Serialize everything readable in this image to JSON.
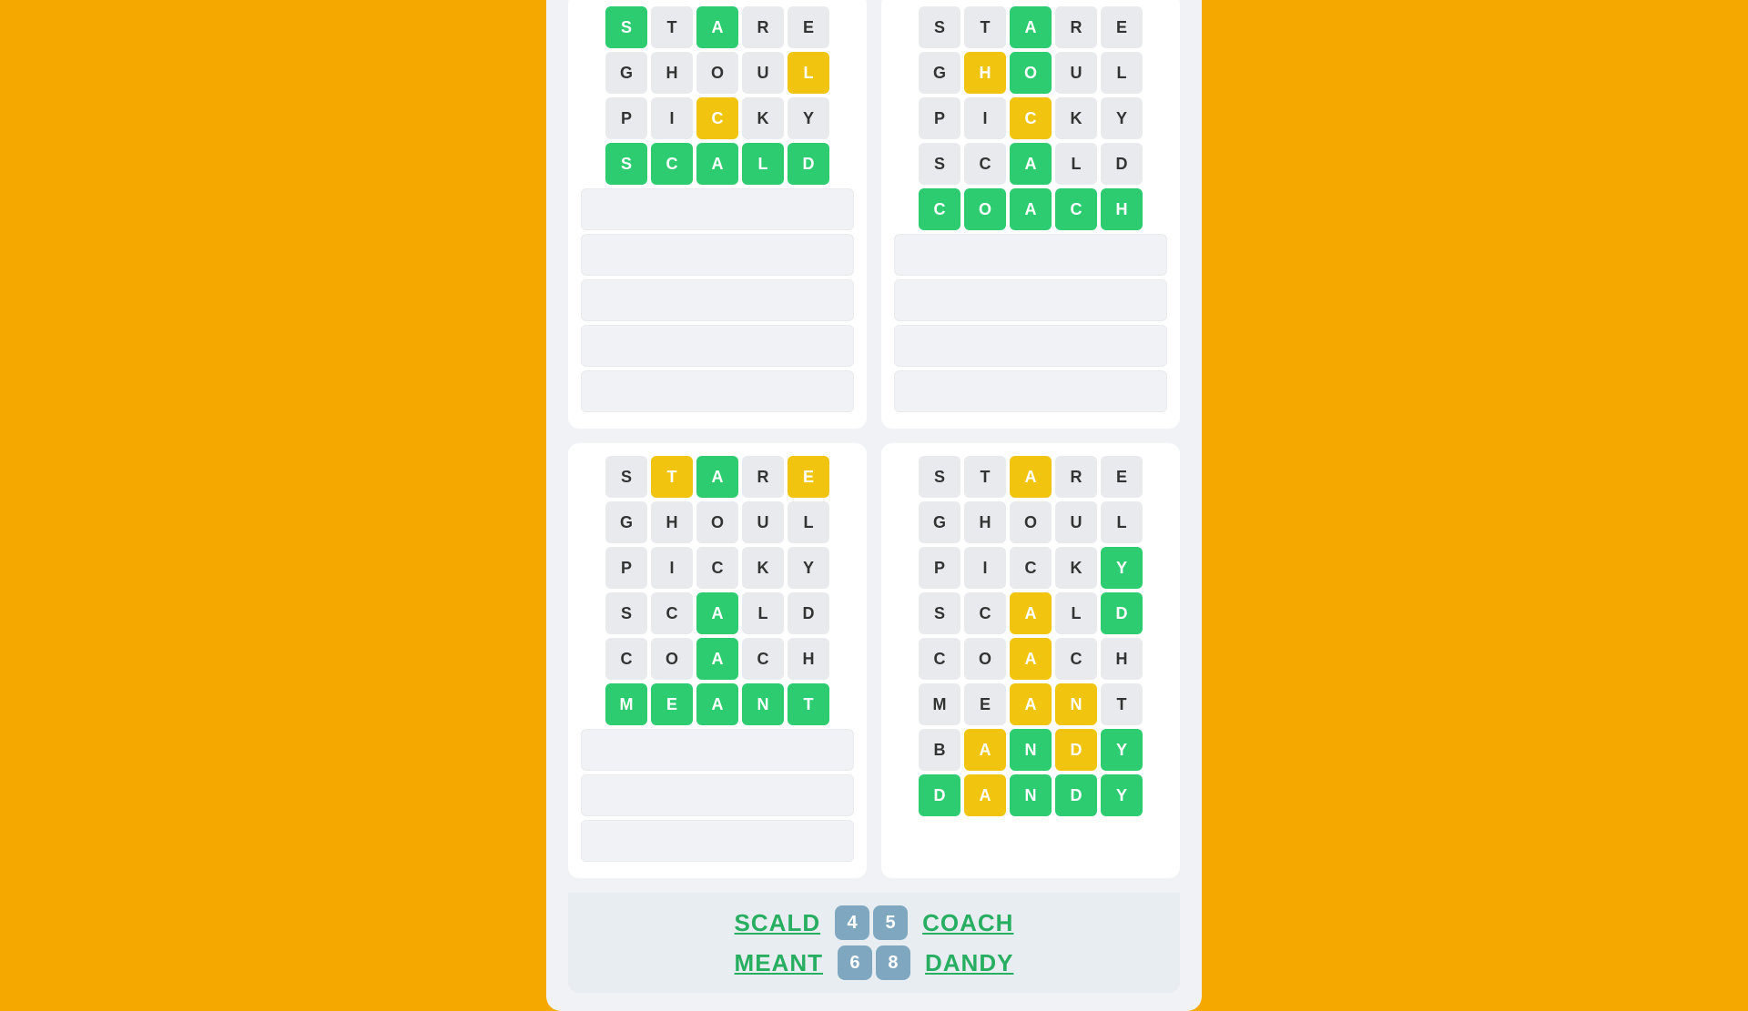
{
  "background_color": "#F5A800",
  "grids": [
    {
      "id": "top-left",
      "rows": [
        [
          {
            "letter": "S",
            "state": "green"
          },
          {
            "letter": "T",
            "state": "normal"
          },
          {
            "letter": "A",
            "state": "green"
          },
          {
            "letter": "R",
            "state": "normal"
          },
          {
            "letter": "E",
            "state": "normal"
          }
        ],
        [
          {
            "letter": "G",
            "state": "normal"
          },
          {
            "letter": "H",
            "state": "normal"
          },
          {
            "letter": "O",
            "state": "normal"
          },
          {
            "letter": "U",
            "state": "normal"
          },
          {
            "letter": "L",
            "state": "yellow"
          }
        ],
        [
          {
            "letter": "P",
            "state": "normal"
          },
          {
            "letter": "I",
            "state": "normal"
          },
          {
            "letter": "C",
            "state": "yellow"
          },
          {
            "letter": "K",
            "state": "normal"
          },
          {
            "letter": "Y",
            "state": "normal"
          }
        ],
        [
          {
            "letter": "S",
            "state": "green"
          },
          {
            "letter": "C",
            "state": "green"
          },
          {
            "letter": "A",
            "state": "green"
          },
          {
            "letter": "L",
            "state": "green"
          },
          {
            "letter": "D",
            "state": "green"
          }
        ]
      ],
      "empty_rows": 5
    },
    {
      "id": "top-right",
      "rows": [
        [
          {
            "letter": "S",
            "state": "normal"
          },
          {
            "letter": "T",
            "state": "normal"
          },
          {
            "letter": "A",
            "state": "green"
          },
          {
            "letter": "R",
            "state": "normal"
          },
          {
            "letter": "E",
            "state": "normal"
          }
        ],
        [
          {
            "letter": "G",
            "state": "normal"
          },
          {
            "letter": "H",
            "state": "yellow"
          },
          {
            "letter": "O",
            "state": "green"
          },
          {
            "letter": "U",
            "state": "normal"
          },
          {
            "letter": "L",
            "state": "normal"
          }
        ],
        [
          {
            "letter": "P",
            "state": "normal"
          },
          {
            "letter": "I",
            "state": "normal"
          },
          {
            "letter": "C",
            "state": "yellow"
          },
          {
            "letter": "K",
            "state": "normal"
          },
          {
            "letter": "Y",
            "state": "normal"
          }
        ],
        [
          {
            "letter": "S",
            "state": "normal"
          },
          {
            "letter": "C",
            "state": "normal"
          },
          {
            "letter": "A",
            "state": "green"
          },
          {
            "letter": "L",
            "state": "normal"
          },
          {
            "letter": "D",
            "state": "normal"
          }
        ],
        [
          {
            "letter": "C",
            "state": "green"
          },
          {
            "letter": "O",
            "state": "green"
          },
          {
            "letter": "A",
            "state": "green"
          },
          {
            "letter": "C",
            "state": "green"
          },
          {
            "letter": "H",
            "state": "green"
          }
        ]
      ],
      "empty_rows": 4
    },
    {
      "id": "bottom-left",
      "rows": [
        [
          {
            "letter": "S",
            "state": "normal"
          },
          {
            "letter": "T",
            "state": "yellow"
          },
          {
            "letter": "A",
            "state": "green"
          },
          {
            "letter": "R",
            "state": "normal"
          },
          {
            "letter": "E",
            "state": "yellow"
          }
        ],
        [
          {
            "letter": "G",
            "state": "normal"
          },
          {
            "letter": "H",
            "state": "normal"
          },
          {
            "letter": "O",
            "state": "normal"
          },
          {
            "letter": "U",
            "state": "normal"
          },
          {
            "letter": "L",
            "state": "normal"
          }
        ],
        [
          {
            "letter": "P",
            "state": "normal"
          },
          {
            "letter": "I",
            "state": "normal"
          },
          {
            "letter": "C",
            "state": "normal"
          },
          {
            "letter": "K",
            "state": "normal"
          },
          {
            "letter": "Y",
            "state": "normal"
          }
        ],
        [
          {
            "letter": "S",
            "state": "normal"
          },
          {
            "letter": "C",
            "state": "normal"
          },
          {
            "letter": "A",
            "state": "green"
          },
          {
            "letter": "L",
            "state": "normal"
          },
          {
            "letter": "D",
            "state": "normal"
          }
        ],
        [
          {
            "letter": "C",
            "state": "normal"
          },
          {
            "letter": "O",
            "state": "normal"
          },
          {
            "letter": "A",
            "state": "green"
          },
          {
            "letter": "C",
            "state": "normal"
          },
          {
            "letter": "H",
            "state": "normal"
          }
        ],
        [
          {
            "letter": "M",
            "state": "green"
          },
          {
            "letter": "E",
            "state": "green"
          },
          {
            "letter": "A",
            "state": "green"
          },
          {
            "letter": "N",
            "state": "green"
          },
          {
            "letter": "T",
            "state": "green"
          }
        ]
      ],
      "empty_rows": 3
    },
    {
      "id": "bottom-right",
      "rows": [
        [
          {
            "letter": "S",
            "state": "normal"
          },
          {
            "letter": "T",
            "state": "normal"
          },
          {
            "letter": "A",
            "state": "yellow"
          },
          {
            "letter": "R",
            "state": "normal"
          },
          {
            "letter": "E",
            "state": "normal"
          }
        ],
        [
          {
            "letter": "G",
            "state": "normal"
          },
          {
            "letter": "H",
            "state": "normal"
          },
          {
            "letter": "O",
            "state": "normal"
          },
          {
            "letter": "U",
            "state": "normal"
          },
          {
            "letter": "L",
            "state": "normal"
          }
        ],
        [
          {
            "letter": "P",
            "state": "normal"
          },
          {
            "letter": "I",
            "state": "normal"
          },
          {
            "letter": "C",
            "state": "normal"
          },
          {
            "letter": "K",
            "state": "normal"
          },
          {
            "letter": "Y",
            "state": "green"
          }
        ],
        [
          {
            "letter": "S",
            "state": "normal"
          },
          {
            "letter": "C",
            "state": "normal"
          },
          {
            "letter": "A",
            "state": "yellow"
          },
          {
            "letter": "L",
            "state": "normal"
          },
          {
            "letter": "D",
            "state": "green"
          }
        ],
        [
          {
            "letter": "C",
            "state": "normal"
          },
          {
            "letter": "O",
            "state": "normal"
          },
          {
            "letter": "A",
            "state": "yellow"
          },
          {
            "letter": "C",
            "state": "normal"
          },
          {
            "letter": "H",
            "state": "normal"
          }
        ],
        [
          {
            "letter": "M",
            "state": "normal"
          },
          {
            "letter": "E",
            "state": "normal"
          },
          {
            "letter": "A",
            "state": "yellow"
          },
          {
            "letter": "N",
            "state": "yellow"
          },
          {
            "letter": "T",
            "state": "normal"
          }
        ],
        [
          {
            "letter": "B",
            "state": "normal"
          },
          {
            "letter": "A",
            "state": "yellow"
          },
          {
            "letter": "N",
            "state": "green"
          },
          {
            "letter": "D",
            "state": "yellow"
          },
          {
            "letter": "Y",
            "state": "green"
          }
        ],
        [
          {
            "letter": "D",
            "state": "green"
          },
          {
            "letter": "A",
            "state": "yellow"
          },
          {
            "letter": "N",
            "state": "green"
          },
          {
            "letter": "D",
            "state": "green"
          },
          {
            "letter": "Y",
            "state": "green"
          }
        ]
      ],
      "empty_rows": 0
    }
  ],
  "footer": {
    "row1": {
      "word_left": "SCALD",
      "score_left": "4",
      "score_right": "5",
      "word_right": "COACH"
    },
    "row2": {
      "word_left": "MEANT",
      "score_left": "6",
      "score_right": "8",
      "word_right": "DANDY"
    }
  }
}
